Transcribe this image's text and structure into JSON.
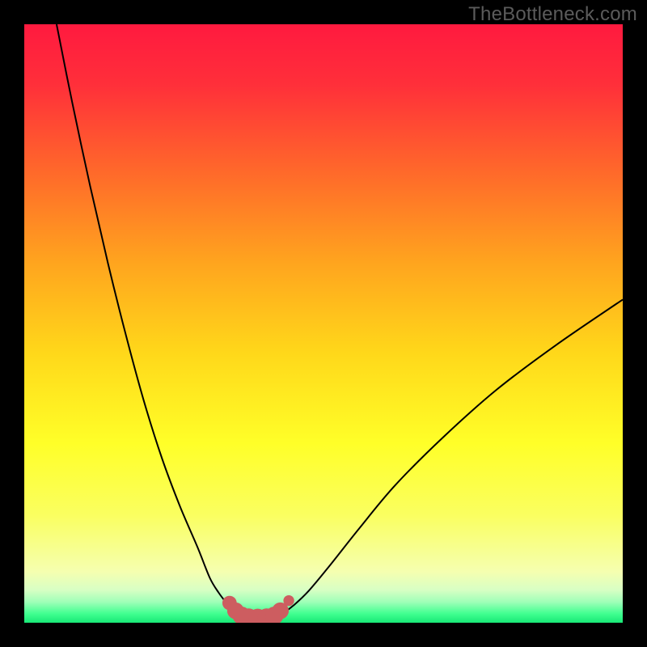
{
  "watermark": "TheBottleneck.com",
  "colors": {
    "frame": "#000000",
    "curve": "#000000",
    "marker_fill": "#cd5d60",
    "marker_stroke": "#cd5d60",
    "gradient_stops": [
      {
        "offset": 0.0,
        "color": "#ff1a3f"
      },
      {
        "offset": 0.1,
        "color": "#ff2f3a"
      },
      {
        "offset": 0.25,
        "color": "#ff6a2a"
      },
      {
        "offset": 0.4,
        "color": "#ffa51e"
      },
      {
        "offset": 0.55,
        "color": "#ffd81a"
      },
      {
        "offset": 0.7,
        "color": "#ffff28"
      },
      {
        "offset": 0.82,
        "color": "#faff60"
      },
      {
        "offset": 0.915,
        "color": "#f5ffb0"
      },
      {
        "offset": 0.945,
        "color": "#d8ffc4"
      },
      {
        "offset": 0.965,
        "color": "#a0ffb8"
      },
      {
        "offset": 0.985,
        "color": "#40ff90"
      },
      {
        "offset": 1.0,
        "color": "#18e876"
      }
    ]
  },
  "chart_data": {
    "type": "line",
    "title": "",
    "xlabel": "",
    "ylabel": "",
    "xlim": [
      0,
      100
    ],
    "ylim": [
      0,
      100
    ],
    "grid": false,
    "series": [
      {
        "name": "left-branch",
        "x": [
          5.4,
          8.0,
          11.0,
          14.0,
          17.0,
          20.0,
          23.0,
          26.0,
          29.0,
          31.0,
          32.5,
          33.8,
          34.8,
          35.5,
          36.0
        ],
        "y": [
          100.0,
          87.0,
          73.0,
          60.0,
          48.0,
          37.0,
          27.5,
          19.5,
          12.5,
          7.5,
          5.0,
          3.3,
          2.2,
          1.5,
          1.1
        ]
      },
      {
        "name": "valley-floor",
        "x": [
          36.0,
          37.5,
          39.0,
          40.5,
          42.0
        ],
        "y": [
          1.1,
          0.9,
          0.85,
          0.9,
          1.1
        ]
      },
      {
        "name": "right-branch",
        "x": [
          42.0,
          43.5,
          45.0,
          47.5,
          51.0,
          56.0,
          62.0,
          70.0,
          79.0,
          89.0,
          100.0
        ],
        "y": [
          1.1,
          1.8,
          2.9,
          5.3,
          9.5,
          15.8,
          23.0,
          31.0,
          39.0,
          46.5,
          54.0
        ]
      }
    ],
    "markers": {
      "name": "valley-markers",
      "points": [
        {
          "x": 34.3,
          "y": 3.3,
          "r": 1.2
        },
        {
          "x": 35.3,
          "y": 2.0,
          "r": 1.4
        },
        {
          "x": 36.3,
          "y": 1.2,
          "r": 1.5
        },
        {
          "x": 37.5,
          "y": 0.9,
          "r": 1.5
        },
        {
          "x": 39.0,
          "y": 0.85,
          "r": 1.5
        },
        {
          "x": 40.5,
          "y": 0.9,
          "r": 1.5
        },
        {
          "x": 41.8,
          "y": 1.2,
          "r": 1.5
        },
        {
          "x": 42.8,
          "y": 2.0,
          "r": 1.4
        },
        {
          "x": 44.2,
          "y": 3.7,
          "r": 0.9
        }
      ]
    }
  }
}
